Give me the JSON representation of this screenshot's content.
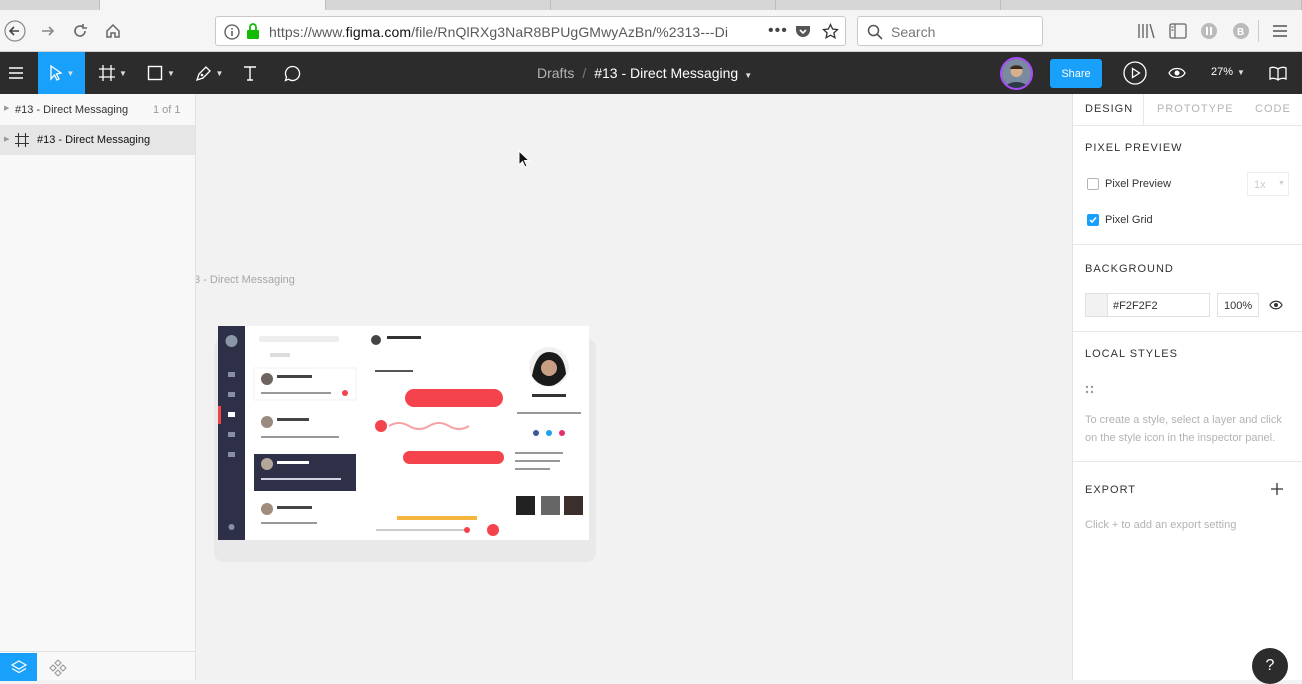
{
  "browser": {
    "url_prefix": "https://www.",
    "url_domain": "figma.com",
    "url_rest": "/file/RnQlRXg3NaR8BPUgGMwyAzBn/%2313---Di",
    "search_placeholder": "Search"
  },
  "toolbar": {
    "breadcrumb_parent": "Drafts",
    "breadcrumb_separator": "/",
    "file_name": "#13 - Direct Messaging",
    "share_label": "Share",
    "zoom_level": "27%",
    "accent_color": "#18a0fb"
  },
  "left_panel": {
    "page_name": "#13 - Direct Messaging",
    "page_count": "1 of 1",
    "layer_name": "#13 - Direct Messaging"
  },
  "canvas": {
    "frame_label": "3 - Direct Messaging",
    "background_color": "#f2f2f2"
  },
  "right_panel": {
    "tabs": [
      "DESIGN",
      "PROTOTYPE",
      "CODE"
    ],
    "pixel_preview": {
      "title": "PIXEL PREVIEW",
      "preview_label": "Pixel Preview",
      "preview_checked": false,
      "scale_value": "1x",
      "grid_label": "Pixel Grid",
      "grid_checked": true
    },
    "background": {
      "title": "BACKGROUND",
      "hex_value": "#F2F2F2",
      "opacity": "100%"
    },
    "local_styles": {
      "title": "LOCAL STYLES",
      "hint": "To create a style, select a layer and click on the style icon in the inspector panel."
    },
    "export": {
      "title": "EXPORT",
      "hint": "Click + to add an export setting"
    },
    "help_label": "?"
  }
}
